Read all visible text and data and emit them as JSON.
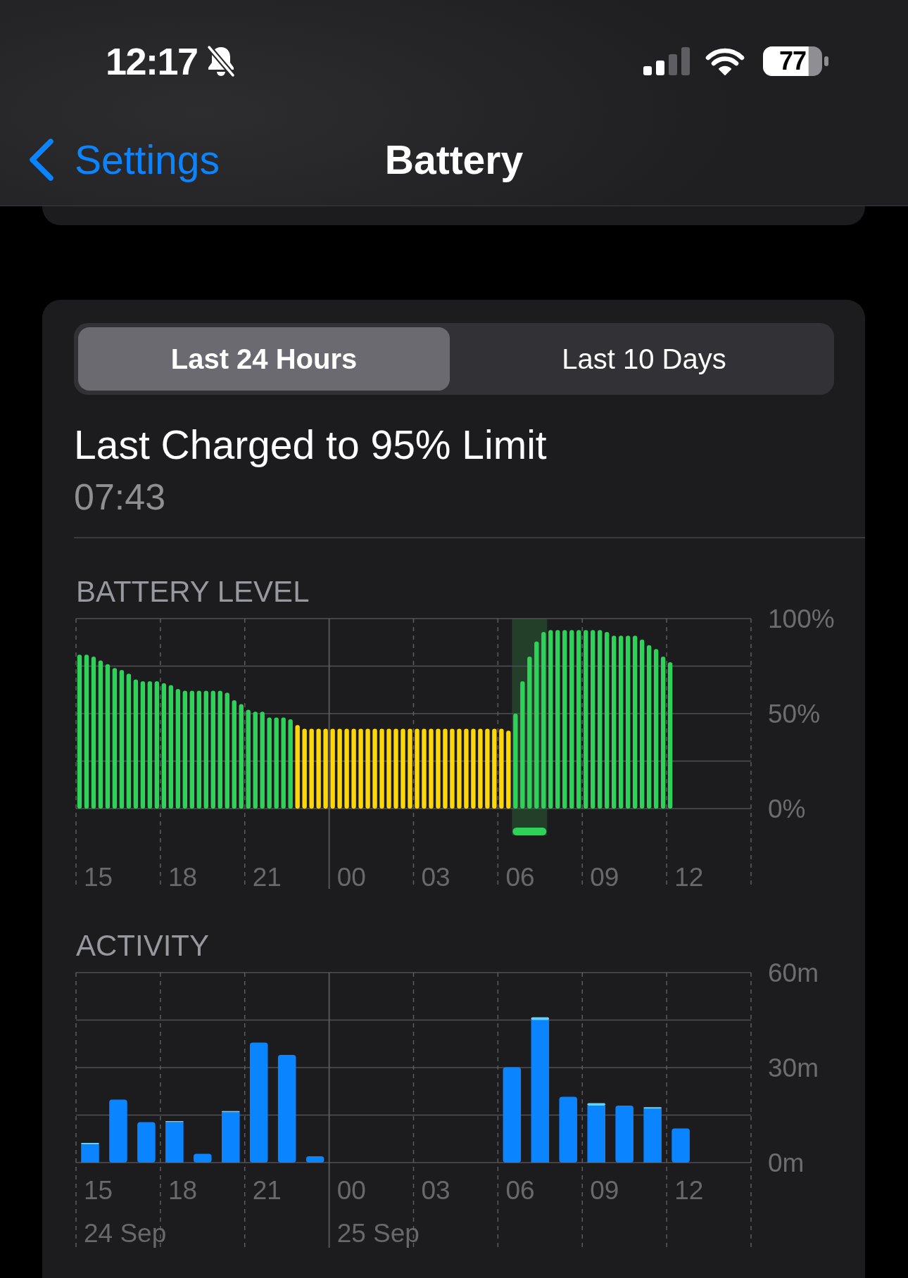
{
  "status_bar": {
    "time": "12:17",
    "silent": true,
    "battery": {
      "level": 0.77,
      "percentage": "77"
    }
  },
  "nav_bar": {
    "back_label": "Settings",
    "title": "Battery"
  },
  "period_tabs": [
    {
      "label": "Last 24 Hours",
      "selected": true
    },
    {
      "label": "Last 10 Days",
      "selected": false
    }
  ],
  "last_charged": {
    "title": "Last Charged to 95% Limit",
    "time": "07:43"
  },
  "battery_level": {
    "chart_data": {
      "type": "bar",
      "title": "BATTERY LEVEL",
      "categories": [
        null,
        null,
        null,
        "15",
        null,
        null,
        null,
        null,
        null,
        null,
        null,
        null,
        null,
        null,
        null,
        "18",
        null,
        null,
        null,
        null,
        null,
        null,
        null,
        null,
        null,
        null,
        null,
        "21",
        null,
        null,
        null,
        null,
        null,
        null,
        null,
        null,
        null,
        null,
        null,
        "00",
        null,
        null,
        null,
        null,
        null,
        null,
        null,
        null,
        null,
        null,
        null,
        "03",
        null,
        null,
        null,
        null,
        null,
        null,
        null,
        null,
        null,
        null,
        null,
        "06",
        null,
        null,
        null,
        null,
        null,
        null,
        null,
        null,
        null,
        null,
        null,
        "09",
        null,
        null,
        null,
        null,
        null,
        null,
        null,
        null,
        null,
        null,
        null,
        "12",
        null,
        null,
        null,
        null,
        null,
        null,
        null,
        null
      ],
      "series": [
        {
          "color": "#30d158",
          "values": [
            81,
            81,
            80,
            78,
            76,
            74,
            73,
            71,
            68,
            67,
            67,
            67,
            66,
            65,
            63,
            62,
            62,
            62,
            62,
            62,
            62,
            61,
            57,
            55,
            52,
            51,
            51,
            48,
            48,
            48,
            47,
            null,
            null,
            null,
            null,
            null,
            null,
            null,
            null,
            null,
            null,
            null,
            null,
            null,
            null,
            null,
            null,
            null,
            null,
            null,
            null,
            null,
            null,
            null,
            null,
            null,
            null,
            null,
            null,
            null,
            null,
            null,
            50,
            67,
            80,
            88,
            93,
            94,
            94,
            94,
            94,
            94,
            94,
            94,
            94,
            93,
            91,
            91,
            91,
            91,
            89,
            86,
            84,
            80,
            77,
            null,
            null,
            null,
            null,
            null,
            null,
            null,
            null,
            null,
            null,
            null
          ]
        },
        {
          "color": "#ffd60a",
          "values": [
            null,
            null,
            null,
            null,
            null,
            null,
            null,
            null,
            null,
            null,
            null,
            null,
            null,
            null,
            null,
            null,
            null,
            null,
            null,
            null,
            null,
            null,
            null,
            null,
            null,
            null,
            null,
            null,
            null,
            null,
            null,
            44,
            42,
            42,
            42,
            42,
            42,
            42,
            42,
            42,
            42,
            42,
            42,
            42,
            42,
            42,
            42,
            42,
            42,
            42,
            42,
            42,
            42,
            42,
            42,
            42,
            42,
            42,
            42,
            42,
            42,
            41,
            null,
            null,
            null,
            null,
            null,
            null,
            null,
            null,
            null,
            null,
            null,
            null,
            null,
            null,
            null,
            null,
            null,
            null,
            null,
            null,
            null,
            null,
            null,
            null,
            null,
            null,
            null,
            null,
            null,
            null,
            null,
            null,
            null,
            null
          ]
        }
      ],
      "stacked": true,
      "grid": true,
      "ylim": [
        0,
        100
      ],
      "yticks": [
        {
          "value": 0,
          "label": "0%"
        },
        {
          "value": 50,
          "label": "50%"
        },
        {
          "value": 100,
          "label": "100%"
        }
      ]
    }
  },
  "activity": {
    "chart_data": {
      "type": "bar",
      "title": "ACTIVITY",
      "categories": [
        "15",
        null,
        null,
        "18",
        null,
        null,
        "21",
        null,
        null,
        "00",
        null,
        null,
        "03",
        null,
        null,
        "06",
        null,
        null,
        "09",
        null,
        null,
        "12",
        null,
        null
      ],
      "series": [
        {
          "color": "#0a84ff",
          "values": [
            5.7,
            19.9,
            12.8,
            12.8,
            2.8,
            15.9,
            37.9,
            34,
            2,
            null,
            null,
            null,
            null,
            null,
            null,
            30.1,
            45,
            20.8,
            18,
            18,
            17,
            10.8,
            null,
            null
          ]
        },
        {
          "color": "#64d2ff",
          "values": [
            0.5,
            null,
            null,
            0.3,
            null,
            0.4,
            null,
            null,
            null,
            null,
            null,
            null,
            null,
            null,
            null,
            null,
            0.9,
            null,
            0.8,
            null,
            0.5,
            null,
            null,
            null
          ]
        }
      ],
      "stacked": true,
      "grid": true,
      "ylim": [
        0,
        60
      ],
      "yticks": [
        {
          "value": 0,
          "label": "0m"
        },
        {
          "value": 30,
          "label": "30m"
        },
        {
          "value": 60,
          "label": "60m"
        }
      ],
      "annotations": [
        "24 Sep",
        "25 Sep"
      ]
    }
  }
}
